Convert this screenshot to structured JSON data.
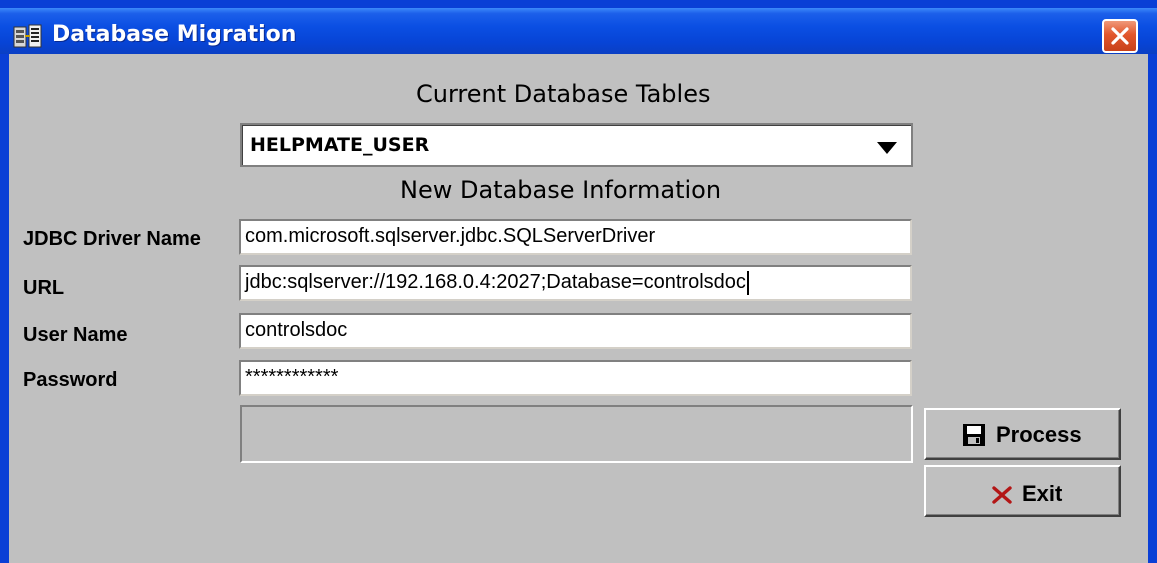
{
  "window": {
    "title": "Database Migration",
    "app_icon": "database-migration-app-icon",
    "close_icon": "close-icon"
  },
  "current_tables": {
    "heading": "Current Database Tables",
    "selected_table": "HELPMATE_USER",
    "dropdown_icon": "chevron-down-icon"
  },
  "new_db": {
    "heading": "New Database Information",
    "fields": [
      {
        "label": "JDBC Driver Name",
        "value": "com.microsoft.sqlserver.jdbc.SQLServerDriver"
      },
      {
        "label": "URL",
        "value": "jdbc:sqlserver://192.168.0.4:2027;Database=controlsdoc"
      },
      {
        "label": "User Name",
        "value": "controlsdoc"
      },
      {
        "label": "Password",
        "value": "************"
      }
    ]
  },
  "status": {
    "text": ""
  },
  "actions": {
    "process_label": "Process",
    "process_icon": "save-icon",
    "exit_label": "Exit",
    "exit_icon": "x-icon"
  },
  "colors": {
    "titlebar": "#0b4fe3",
    "client_background": "#c0c0c0",
    "close_button": "#e2562c",
    "exit_x": "#b31616"
  }
}
